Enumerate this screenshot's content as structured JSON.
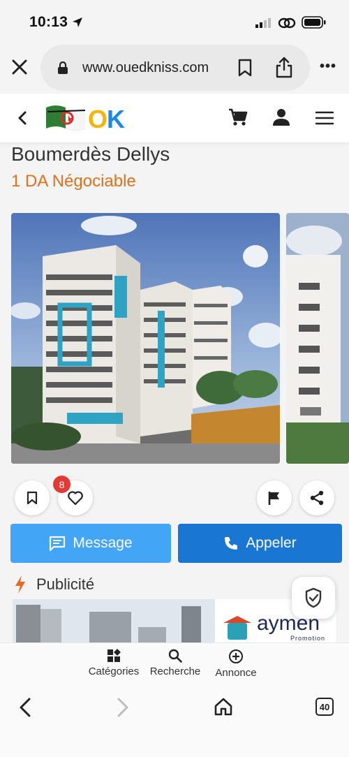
{
  "status_bar": {
    "time": "10:13",
    "icons": [
      "location-arrow-icon",
      "signal-icon",
      "link-icon",
      "battery-icon"
    ]
  },
  "browser": {
    "url": "www.ouedkniss.com",
    "icons": [
      "close-icon",
      "lock-icon",
      "bookmark-icon",
      "share-icon",
      "more-icon"
    ],
    "more_label": "•••"
  },
  "site_header": {
    "logo_text": "OK",
    "icons": [
      "chevron-left-icon",
      "cart-icon",
      "user-icon",
      "hamburger-menu-icon"
    ]
  },
  "listing": {
    "title": "Boumerdès Dellys",
    "price": "1 DA Négociable"
  },
  "actions": {
    "likes_count": "8",
    "message_label": "Message",
    "call_label": "Appeler"
  },
  "ads": {
    "heading": "Publicité",
    "banner_brand": "aymen",
    "banner_sub": "Promotion"
  },
  "bottom_nav": {
    "items": [
      {
        "label": "Catégories",
        "icon": "categories-icon"
      },
      {
        "label": "Recherche",
        "icon": "search-icon"
      },
      {
        "label": "Annonce",
        "icon": "add-circle-icon"
      }
    ]
  },
  "browser_toolbar": {
    "tabs_count": "40"
  },
  "colors": {
    "price": "#e0701c",
    "message_button": "#42a5f5",
    "call_button": "#1976d2",
    "badge": "#e53935",
    "logo_o": "#f5b400",
    "logo_k": "#1e88e5"
  }
}
